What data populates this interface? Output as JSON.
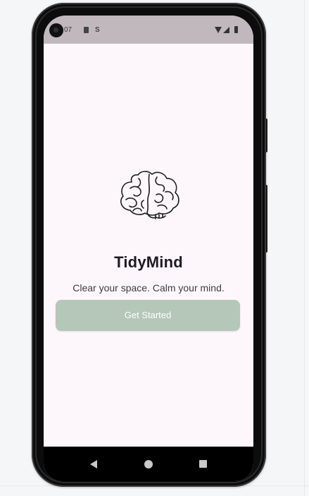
{
  "status_bar": {
    "time": "07",
    "icons": [
      "camera-icon",
      "sim-card-icon",
      "s-icon",
      "wifi-icon",
      "signal-icon",
      "battery-icon"
    ]
  },
  "app": {
    "logo_icon": "brain-icon",
    "title": "TidyMind",
    "tagline": "Clear your space. Calm your mind.",
    "cta_label": "Get Started"
  },
  "navigation": {
    "icons": [
      "back-icon",
      "home-icon",
      "recents-icon"
    ]
  },
  "colors": {
    "background": "#fdf7fb",
    "status_bar": "#c0b8bd",
    "button": "#b4c7b9",
    "button_text": "#ffffff",
    "title_text": "#1f1b20",
    "tagline_text": "#413b42",
    "device": "#0c0c0c",
    "nav_bar": "#000000"
  }
}
